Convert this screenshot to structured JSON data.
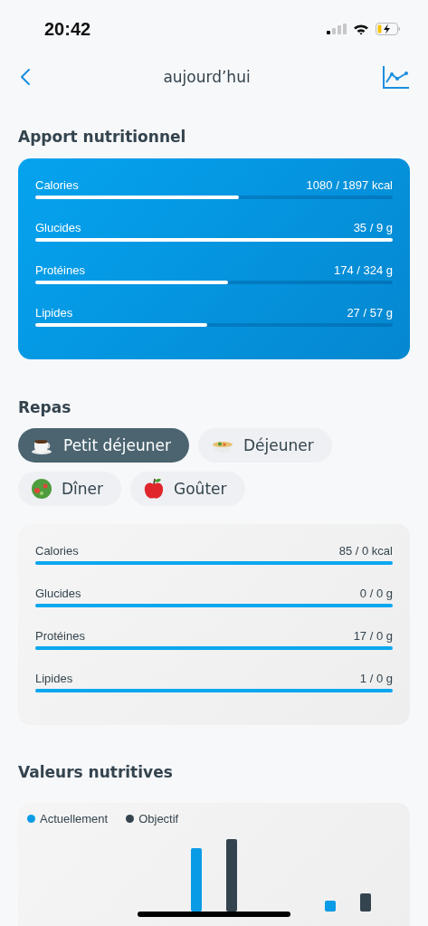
{
  "status_bar": {
    "time": "20:42"
  },
  "nav": {
    "title": "aujourd’hui"
  },
  "intake": {
    "title": "Apport nutritionnel",
    "rows": [
      {
        "label": "Calories",
        "reading": "1080 / 1897 kcal",
        "level": 0.57
      },
      {
        "label": "Glucides",
        "reading": "35 / 9 g",
        "level": 1
      },
      {
        "label": "Protéines",
        "reading": "174 / 324 g",
        "level": 0.54
      },
      {
        "label": "Lipides",
        "reading": "27 / 57 g",
        "level": 0.48
      }
    ]
  },
  "meals": {
    "title": "Repas",
    "tabs": [
      {
        "kind": "coffee",
        "label": "Petit déjeuner",
        "selected": true
      },
      {
        "kind": "soup",
        "label": "Déjeuner",
        "selected": false
      },
      {
        "kind": "salad",
        "label": "Dîner",
        "selected": false
      },
      {
        "kind": "apple",
        "label": "Goûter",
        "selected": false
      }
    ],
    "rows": [
      {
        "label": "Calories",
        "reading": "85 / 0 kcal",
        "level": 1
      },
      {
        "label": "Glucides",
        "reading": "0 / 0 g",
        "level": 1
      },
      {
        "label": "Protéines",
        "reading": "17 / 0 g",
        "level": 1
      },
      {
        "label": "Lipides",
        "reading": "1 / 0 g",
        "level": 1
      }
    ]
  },
  "nutrition": {
    "title": "Valeurs nutritives",
    "legend": [
      {
        "label": "Actuellement",
        "color": "#0a9be6"
      },
      {
        "label": "Objectif",
        "color": "#34444e"
      }
    ]
  }
}
